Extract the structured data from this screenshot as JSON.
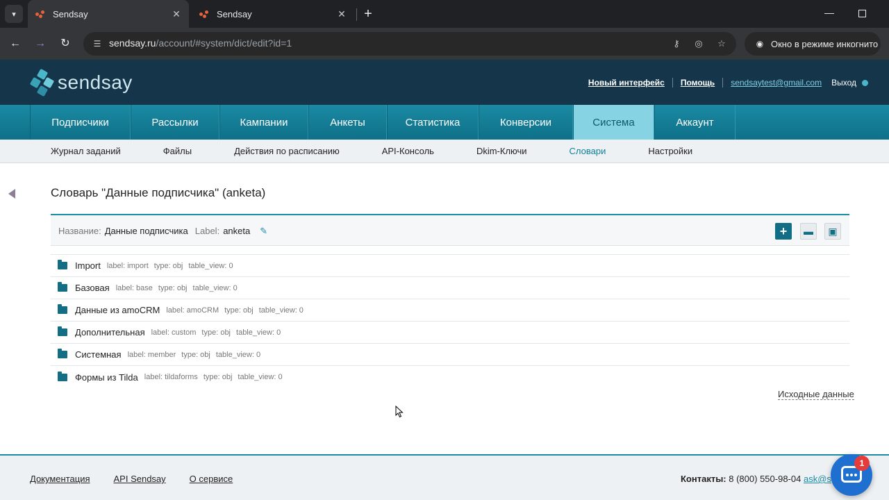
{
  "browser": {
    "tabs": [
      {
        "title": "Sendsay"
      },
      {
        "title": "Sendsay"
      }
    ],
    "url_host": "sendsay.ru",
    "url_path": "/account/#system/dict/edit?id=1",
    "incognito_label": "Окно в режиме инкогнито"
  },
  "header": {
    "logo_text": "sendsay",
    "new_interface": "Новый интерфейс",
    "help": "Помощь",
    "email": "sendsaytest@gmail.com",
    "exit": "Выход"
  },
  "main_nav": {
    "items": [
      "Подписчики",
      "Рассылки",
      "Кампании",
      "Анкеты",
      "Статистика",
      "Конверсии",
      "Система",
      "Аккаунт"
    ],
    "active": "Система"
  },
  "sub_nav": {
    "items": [
      "Журнал заданий",
      "Файлы",
      "Действия по расписанию",
      "API-Консоль",
      "Dkim-Ключи",
      "Словари",
      "Настройки"
    ],
    "active": "Словари"
  },
  "page": {
    "title": "Словарь \"Данные подписчика\" (anketa)",
    "name_label": "Название:",
    "name_value": "Данные подписчика",
    "label_label": "Label:",
    "label_value": "anketa",
    "source_link": "Исходные данные"
  },
  "tree": [
    {
      "name": "Import",
      "label": "label: import",
      "type": "type: obj",
      "table_view": "table_view: 0"
    },
    {
      "name": "Базовая",
      "label": "label: base",
      "type": "type: obj",
      "table_view": "table_view: 0"
    },
    {
      "name": "Данные из amoCRM",
      "label": "label: amoCRM",
      "type": "type: obj",
      "table_view": "table_view: 0"
    },
    {
      "name": "Дополнительная",
      "label": "label: custom",
      "type": "type: obj",
      "table_view": "table_view: 0"
    },
    {
      "name": "Системная",
      "label": "label: member",
      "type": "type: obj",
      "table_view": "table_view: 0"
    },
    {
      "name": "Формы из Tilda",
      "label": "label: tildaforms",
      "type": "type: obj",
      "table_view": "table_view: 0"
    }
  ],
  "footer": {
    "links": [
      "Документация",
      "API Sendsay",
      "О сервисе"
    ],
    "contacts_label": "Контакты:",
    "phone": "8 (800) 550-98-04",
    "email_partial": "ask@s"
  },
  "chat": {
    "badge_count": "1"
  },
  "colors": {
    "header_bg": "#15354a",
    "nav_bg": "#1b8aa3",
    "nav_active": "#86d3e3",
    "accent": "#126e84"
  }
}
